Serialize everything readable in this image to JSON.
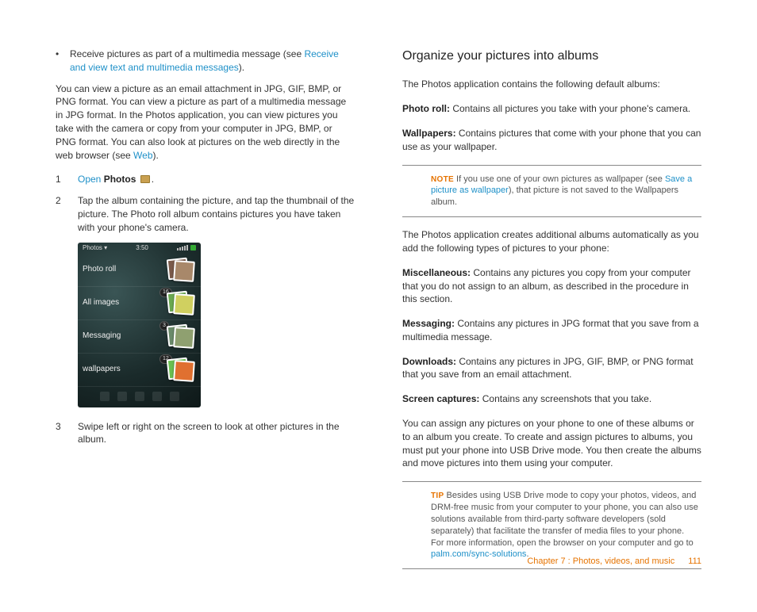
{
  "left": {
    "bullet_prefix": "Receive pictures as part of a multimedia message (see ",
    "bullet_link": "Receive and view text and multimedia messages",
    "bullet_suffix": ").",
    "para1_a": "You can view a picture as an email attachment in JPG, GIF, BMP, or PNG format. You can view a picture as part of a multimedia message in JPG format. In the Photos application, you can view pictures you take with the camera or copy from your computer in JPG, BMP, or PNG format. You can also look at pictures on the web directly in the web browser (see ",
    "para1_link": "Web",
    "para1_b": ").",
    "step1_num": "1",
    "step1_open": "Open",
    "step1_photos": "Photos",
    "step1_dot": ".",
    "step2_num": "2",
    "step2_text": "Tap the album containing the picture, and tap the thumbnail of the picture. The Photo roll album contains pictures you have taken with your phone's camera.",
    "phone": {
      "app": "Photos",
      "time": "3:50",
      "rows": [
        {
          "label": "Photo roll",
          "badge": ""
        },
        {
          "label": "All images",
          "badge": "16"
        },
        {
          "label": "Messaging",
          "badge": "3"
        },
        {
          "label": "wallpapers",
          "badge": "12"
        }
      ]
    },
    "step3_num": "3",
    "step3_text": "Swipe left or right on the screen to look at other pictures in the album."
  },
  "right": {
    "heading": "Organize your pictures into albums",
    "intro": "The Photos application contains the following default albums:",
    "photo_roll_label": "Photo roll:",
    "photo_roll_text": " Contains all pictures you take with your phone's camera.",
    "wallpapers_label": "Wallpapers:",
    "wallpapers_text": " Contains pictures that come with your phone that you can use as your wallpaper.",
    "note_label": "NOTE",
    "note_a": " If you use one of your own pictures as wallpaper (see ",
    "note_link": "Save a picture as wallpaper",
    "note_b": "), that picture is not saved to the Wallpapers album.",
    "auto_intro": "The Photos application creates additional albums automatically as you add the following types of pictures to your phone:",
    "misc_label": "Miscellaneous:",
    "misc_text": " Contains any pictures you copy from your computer that you do not assign to an album, as described in the procedure in this section.",
    "msg_label": "Messaging:",
    "msg_text": " Contains any pictures in JPG format that you save from a multimedia message.",
    "dl_label": "Downloads:",
    "dl_text": " Contains any pictures in JPG, GIF, BMP, or PNG format that you save from an email attachment.",
    "sc_label": "Screen captures:",
    "sc_text": " Contains any screenshots that you take.",
    "assign": "You can assign any pictures on your phone to one of these albums or to an album you create. To create and assign pictures to albums, you must put your phone into USB Drive mode. You then create the albums and move pictures into them using your computer.",
    "tip_label": "TIP",
    "tip_a": " Besides using USB Drive mode to copy your photos, videos, and DRM-free music from your computer to your phone, you can also use solutions available from third-party software developers (sold separately) that facilitate the transfer of media files to your phone. For more information, open the browser on your computer and go to ",
    "tip_link": "palm.com/sync-solutions",
    "tip_b": "."
  },
  "footer": {
    "chapter": "Chapter 7 : Photos, videos, and music",
    "page": "111"
  },
  "tile_colors": {
    "r0_back": "#7a5a4a",
    "r0_front": "#a8886a",
    "r1_back": "#6aa850",
    "r1_front": "#d0d060",
    "r2_back": "#6a8a6a",
    "r2_front": "#8fa070",
    "r3_back": "#6abf50",
    "r3_front": "#e07030"
  }
}
